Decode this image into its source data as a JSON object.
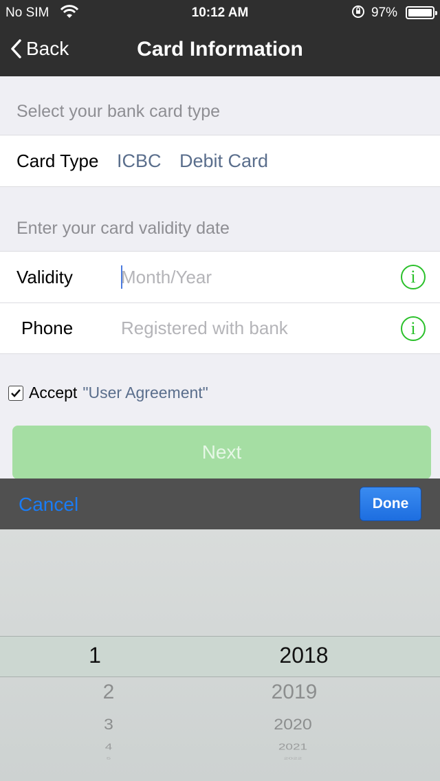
{
  "status_bar": {
    "carrier": "No SIM",
    "time": "10:12 AM",
    "battery": "97%"
  },
  "nav": {
    "back_label": "Back",
    "title": "Card Information"
  },
  "card_type_section": {
    "header": "Select your bank card type",
    "label": "Card Type",
    "bank": "ICBC",
    "card_kind": "Debit Card"
  },
  "validity_section": {
    "header": "Enter your card validity date",
    "validity_label": "Validity",
    "validity_placeholder": "Month/Year",
    "phone_label": "Phone",
    "phone_placeholder": "Registered with bank",
    "info_glyph": "i"
  },
  "agreement": {
    "checked": true,
    "accept_label": "Accept",
    "link_label": "\"User Agreement\""
  },
  "next_label": "Next",
  "picker": {
    "cancel_label": "Cancel",
    "done_label": "Done",
    "months": [
      "1",
      "2",
      "3",
      "4",
      "5"
    ],
    "years": [
      "2018",
      "2019",
      "2020",
      "2021",
      "2022"
    ],
    "selected_month": "1",
    "selected_year": "2018"
  },
  "colors": {
    "nav_bg": "#2f2f2f",
    "accent_link": "#5a6e8c",
    "info_green": "#2ac02a",
    "next_button": "#a5dea3",
    "picker_blue": "#1a7cf5"
  }
}
